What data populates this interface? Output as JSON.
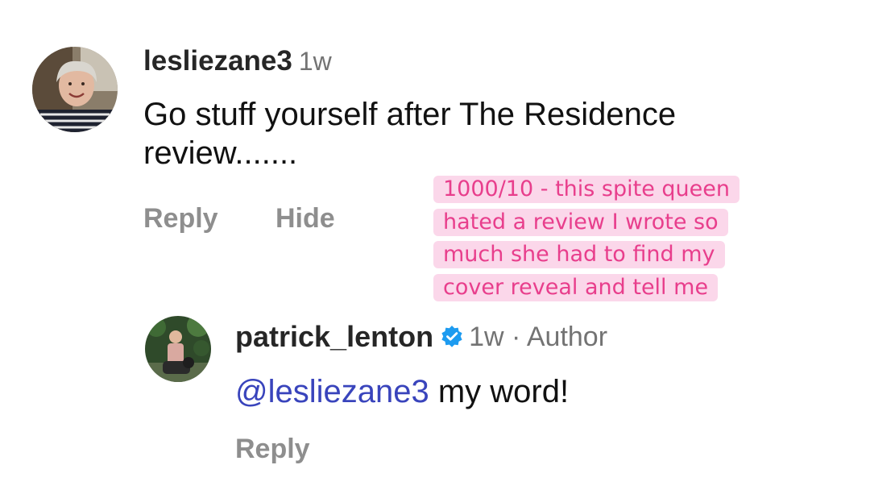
{
  "comment_1": {
    "username": "lesliezane3",
    "time": "1w",
    "text": "Go stuff yourself after The Residence review.......",
    "actions": {
      "reply": "Reply",
      "hide": "Hide"
    },
    "avatar_icon": "user-avatar-photo"
  },
  "annotation": {
    "lines": [
      "1000/10 - this spite queen",
      "hated a review I wrote so",
      "much she had to find my",
      "cover reveal and tell me"
    ],
    "background_color": "#fbd7ea",
    "text_color": "#e83e8c"
  },
  "comment_2": {
    "username": "patrick_lenton",
    "verified_icon": "verified-badge-icon",
    "meta": "1w · Author",
    "mention": "@lesliezane3",
    "text": " my word!",
    "actions": {
      "reply": "Reply"
    },
    "avatar_icon": "user-avatar-photo"
  },
  "colors": {
    "mention": "#3944bc",
    "verified": "#1d9bf0",
    "muted": "#737373"
  }
}
